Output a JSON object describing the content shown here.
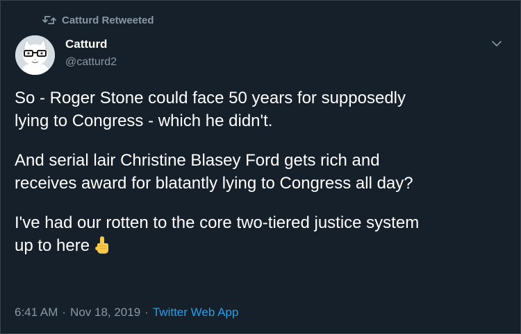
{
  "retweet": {
    "label": "Catturd Retweeted",
    "icon": "retweet-icon"
  },
  "author": {
    "name": "Catturd",
    "handle": "@catturd2",
    "avatar_icon": "cat-avatar"
  },
  "menu": {
    "icon": "chevron-down-icon"
  },
  "tweet": {
    "paragraphs": [
      "So - Roger Stone could face 50 years for supposedly\nlying to Congress - which he didn't.",
      "And serial lair Christine Blasey Ford gets rich and\nreceives award for blatantly lying to Congress all day?",
      "I've had our rotten to the core two-tiered justice system\nup to here"
    ],
    "emoji": "pointing-up-hand-emoji"
  },
  "meta": {
    "time": "6:41 AM",
    "date": "Nov 18, 2019",
    "separator": "·",
    "source": "Twitter Web App"
  },
  "colors": {
    "background": "#15202b",
    "text": "#ffffff",
    "secondary": "#8899a6",
    "link": "#1da1f2",
    "border": "#38444d"
  }
}
